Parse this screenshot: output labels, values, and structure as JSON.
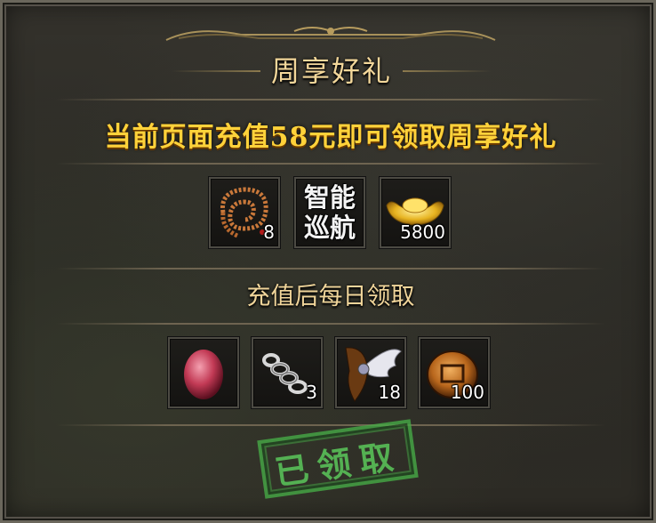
{
  "title": "周享好礼",
  "promo_text": "当前页面充值58元即可领取周享好礼",
  "rewards": [
    {
      "icon": "prayer-beads-icon",
      "count": "8"
    },
    {
      "icon": "auto-navigation-icon",
      "label_line1": "智能",
      "label_line2": "巡航"
    },
    {
      "icon": "gold-ingot-icon",
      "count": "5800"
    }
  ],
  "daily_heading": "充值后每日领取",
  "daily_rewards": [
    {
      "icon": "red-gem-icon"
    },
    {
      "icon": "silver-coil-icon",
      "count": "3"
    },
    {
      "icon": "wing-charm-icon",
      "count": "18"
    },
    {
      "icon": "bronze-token-icon",
      "count": "100"
    }
  ],
  "claimed_stamp": "已领取",
  "colors": {
    "title": "#f3d79a",
    "promo": "#ffd23a",
    "stamp": "#5ac85a"
  }
}
